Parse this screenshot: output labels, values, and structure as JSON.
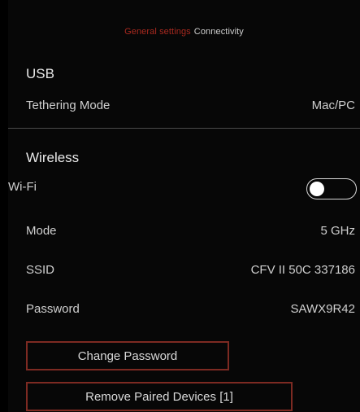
{
  "breadcrumb": {
    "active": "General settings",
    "current": "Connectivity"
  },
  "usb": {
    "title": "USB",
    "tethering_label": "Tethering Mode",
    "tethering_value": "Mac/PC"
  },
  "wireless": {
    "title": "Wireless",
    "wifi_label": "Wi-Fi",
    "wifi_enabled": false,
    "mode_label": "Mode",
    "mode_value": "5 GHz",
    "ssid_label": "SSID",
    "ssid_value": "CFV II 50C 337186",
    "password_label": "Password",
    "password_value": "SAWX9R42"
  },
  "buttons": {
    "change_password": "Change Password",
    "remove_paired": "Remove Paired Devices [1]"
  },
  "colors": {
    "accent": "#a8291f",
    "button_border": "#7d2a22",
    "background": "#070707"
  }
}
